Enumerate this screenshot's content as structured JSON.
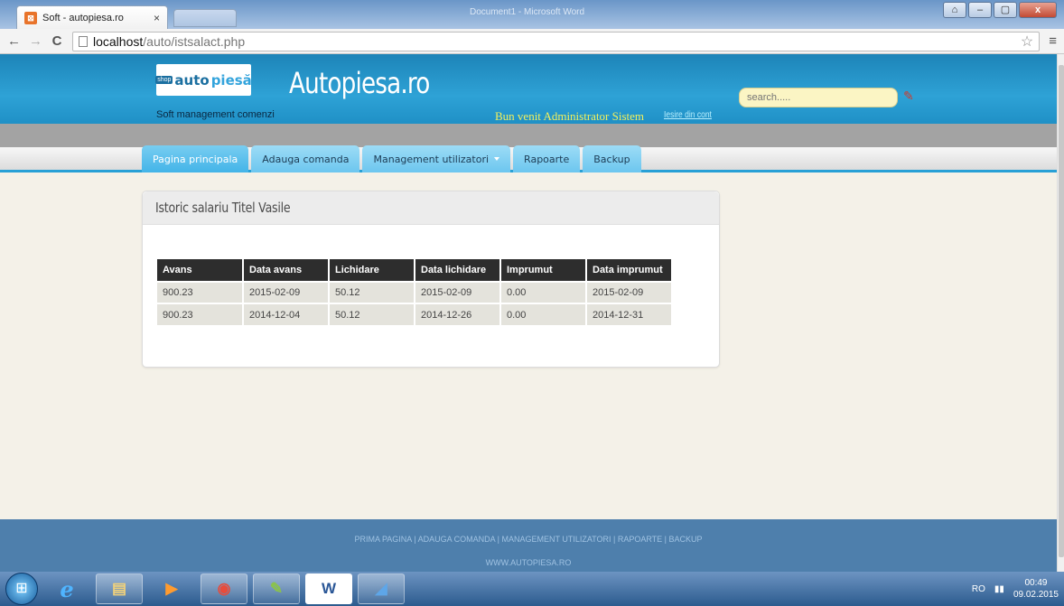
{
  "browser": {
    "tab_title": "Soft - autopiesa.ro",
    "tab_close": "×",
    "background_title": "Document1 - Microsoft Word",
    "url_host": "localhost",
    "url_path": "/auto/istsalact.php",
    "back": "←",
    "forward": "→",
    "reload": "C",
    "star": "☆",
    "menu": "≡",
    "win_min": "–",
    "win_max": "▢",
    "win_close": "x",
    "win_extra": "⌂"
  },
  "header": {
    "logo_badge": "shop",
    "logo_part1": "auto",
    "logo_part2": "piesă",
    "tagline": "Soft management comenzi",
    "site_title": "Autopiesa.ro",
    "welcome": "Bun venit Administrator Sistem",
    "logout": "Iesire din cont",
    "search_placeholder": "search.....",
    "search_icon": "✎"
  },
  "nav": {
    "items": [
      {
        "label": "Pagina principala"
      },
      {
        "label": "Adauga comanda"
      },
      {
        "label": "Management utilizatori"
      },
      {
        "label": "Rapoarte"
      },
      {
        "label": "Backup"
      }
    ]
  },
  "panel": {
    "title": "Istoric salariu Titel Vasile",
    "columns": [
      "Avans",
      "Data avans",
      "Lichidare",
      "Data lichidare",
      "Imprumut",
      "Data imprumut"
    ],
    "rows": [
      [
        "900.23",
        "2015-02-09",
        "50.12",
        "2015-02-09",
        "0.00",
        "2015-02-09"
      ],
      [
        "900.23",
        "2014-12-04",
        "50.12",
        "2014-12-26",
        "0.00",
        "2014-12-31"
      ]
    ]
  },
  "footer": {
    "links": "PRIMA PAGINA | ADAUGA COMANDA | MANAGEMENT UTILIZATORI | RAPOARTE | BACKUP",
    "site": "WWW.AUTOPIESA.RO"
  },
  "taskbar": {
    "start": "⊞",
    "items": [
      "e",
      "▤",
      "▶",
      "◉",
      "✎",
      "W",
      "◢"
    ],
    "lang": "RO",
    "time": "00:49",
    "date": "09.02.2015"
  }
}
